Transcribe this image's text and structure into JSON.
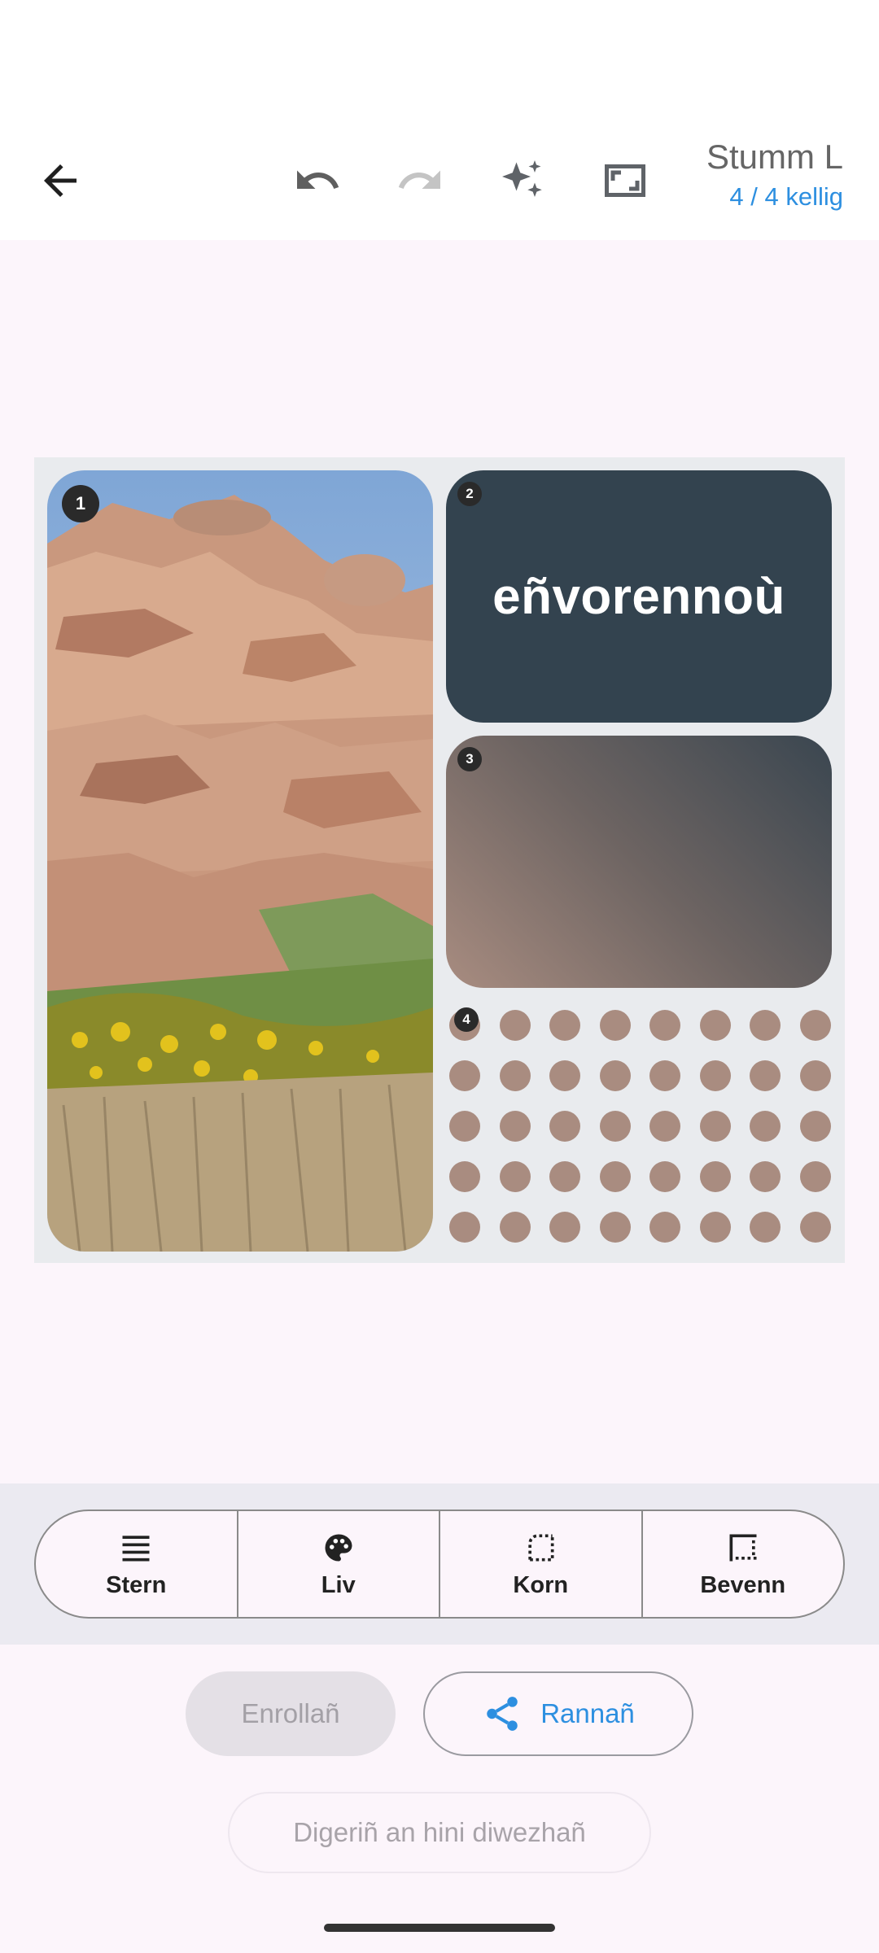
{
  "header": {
    "title": "Stumm L",
    "subtitle": "4 / 4 kellig"
  },
  "collage": {
    "cells": [
      {
        "badge": "1",
        "kind": "photo"
      },
      {
        "badge": "2",
        "kind": "text",
        "text": "eñvorennoù"
      },
      {
        "badge": "3",
        "kind": "gradient"
      },
      {
        "badge": "4",
        "kind": "pattern"
      }
    ]
  },
  "tools": [
    {
      "label": "Stern",
      "icon": "layout-icon"
    },
    {
      "label": "Liv",
      "icon": "palette-icon"
    },
    {
      "label": "Korn",
      "icon": "corner-icon"
    },
    {
      "label": "Bevenn",
      "icon": "border-icon"
    }
  ],
  "actions": {
    "save_label": "Enrollañ",
    "share_label": "Rannañ",
    "download_label": "Digeriñ an hini diwezhañ"
  },
  "colors": {
    "accent": "#2d8fe0",
    "text_cell": "#33434f",
    "dots": "#a98c80"
  }
}
